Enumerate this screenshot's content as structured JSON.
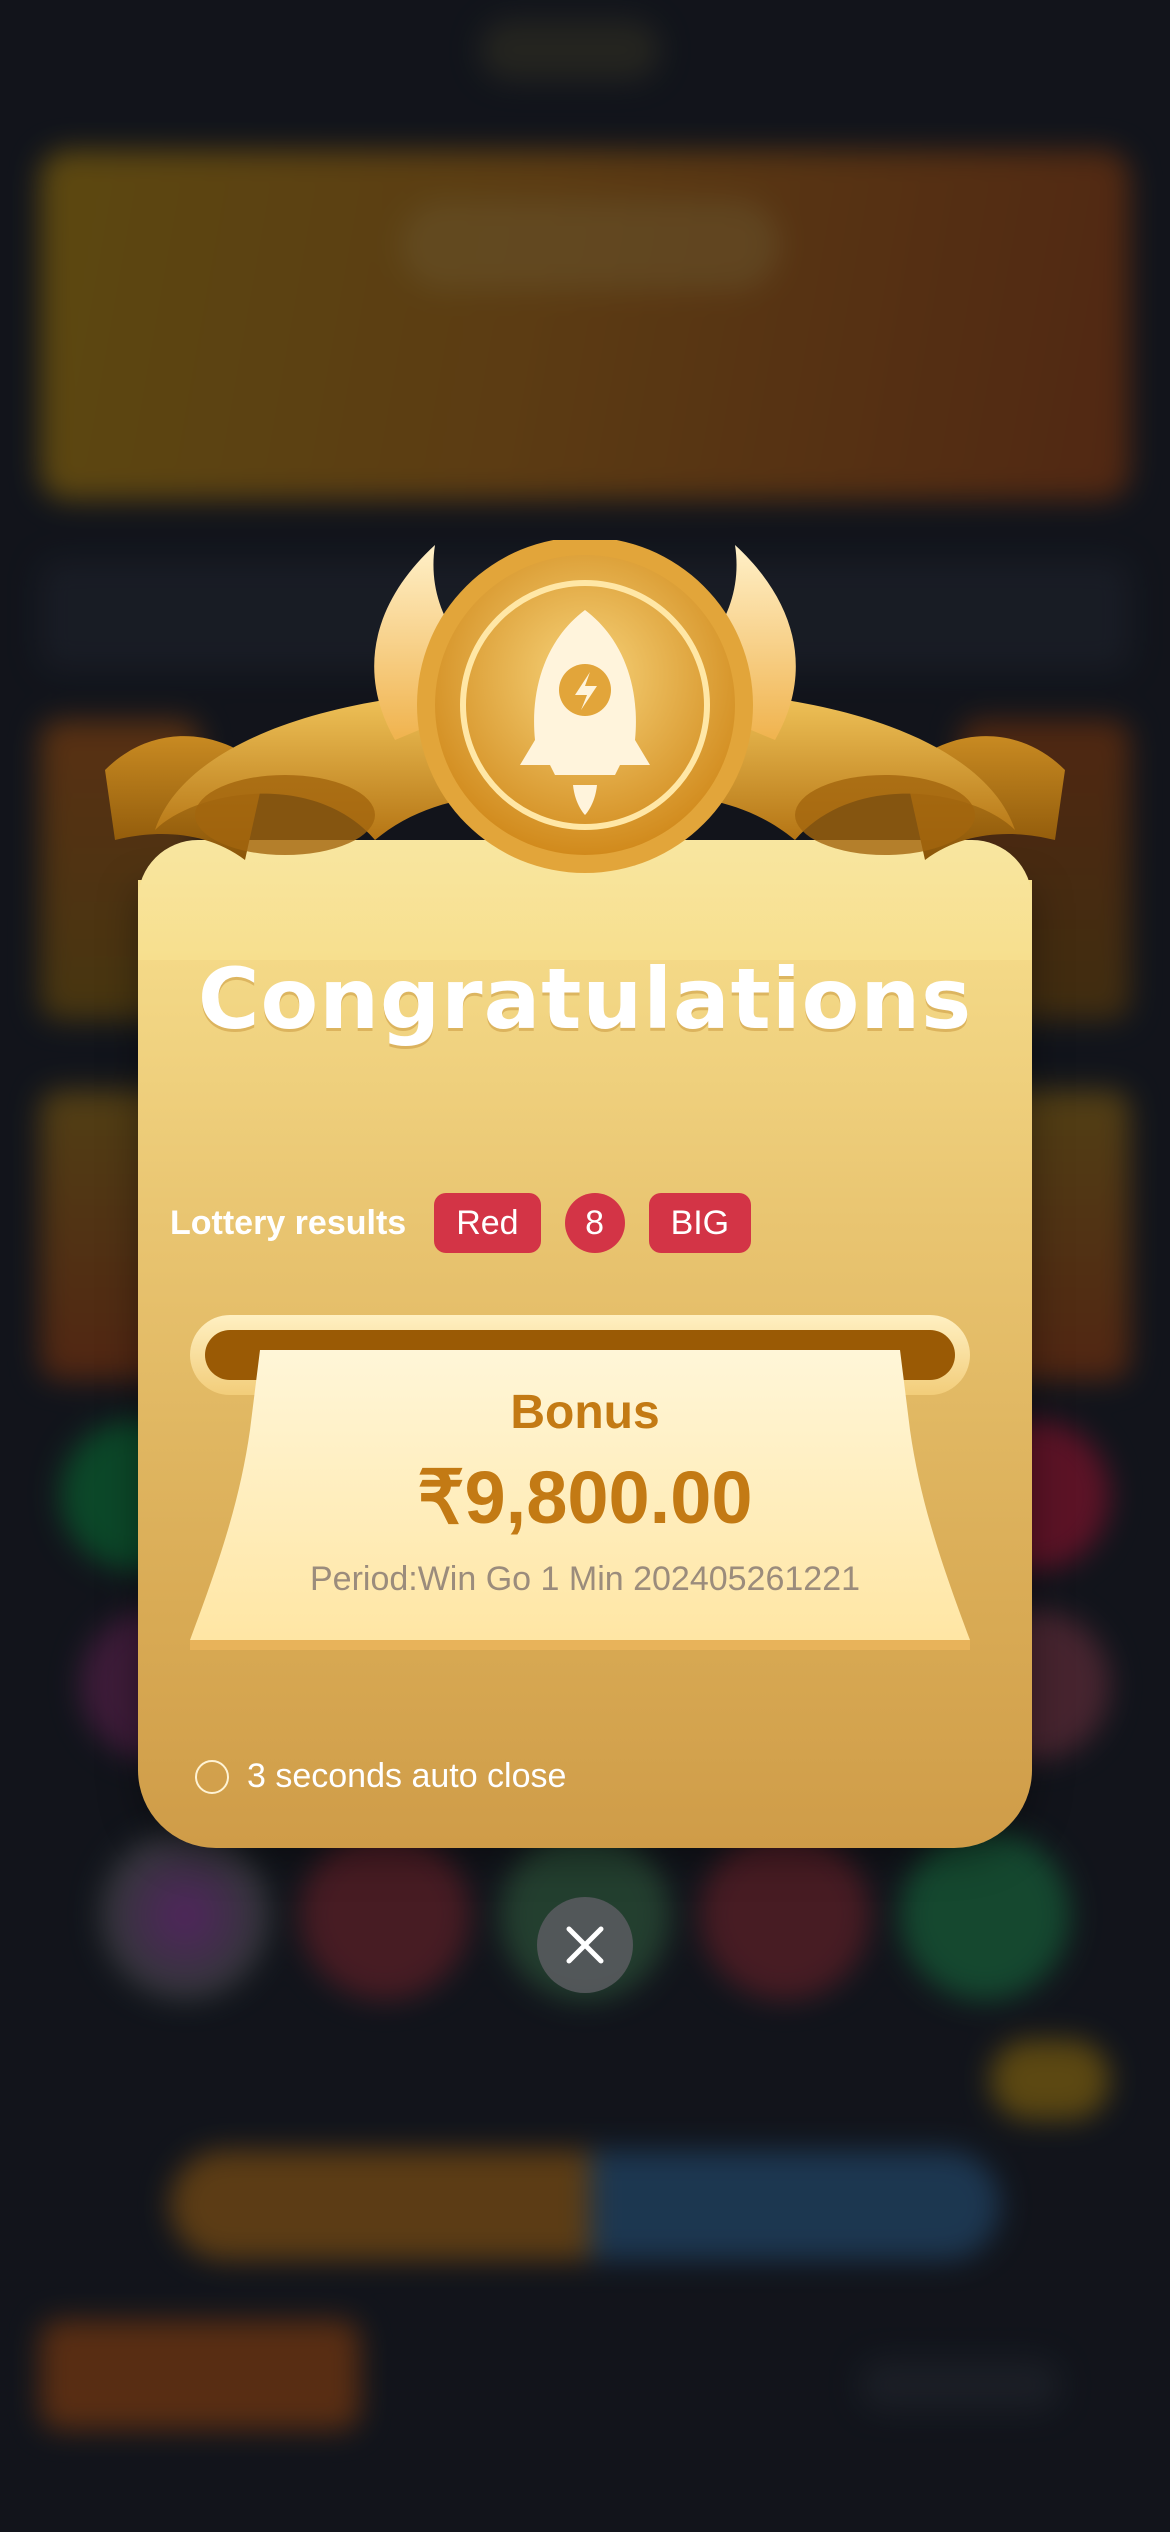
{
  "modal": {
    "title": "Congratulations",
    "lottery": {
      "label": "Lottery results",
      "color": "Red",
      "number": "8",
      "size": "BIG"
    },
    "bonus": {
      "label": "Bonus",
      "amount": "₹9,800.00",
      "period": "Period:Win Go 1 Min 202405261221"
    },
    "auto_close": "3 seconds auto close",
    "icons": [
      "rocket-medal-icon",
      "close-icon"
    ]
  },
  "colors": {
    "gold": "#e9c571",
    "bonus_text": "#c37a14",
    "badge_red": "#d33446"
  }
}
